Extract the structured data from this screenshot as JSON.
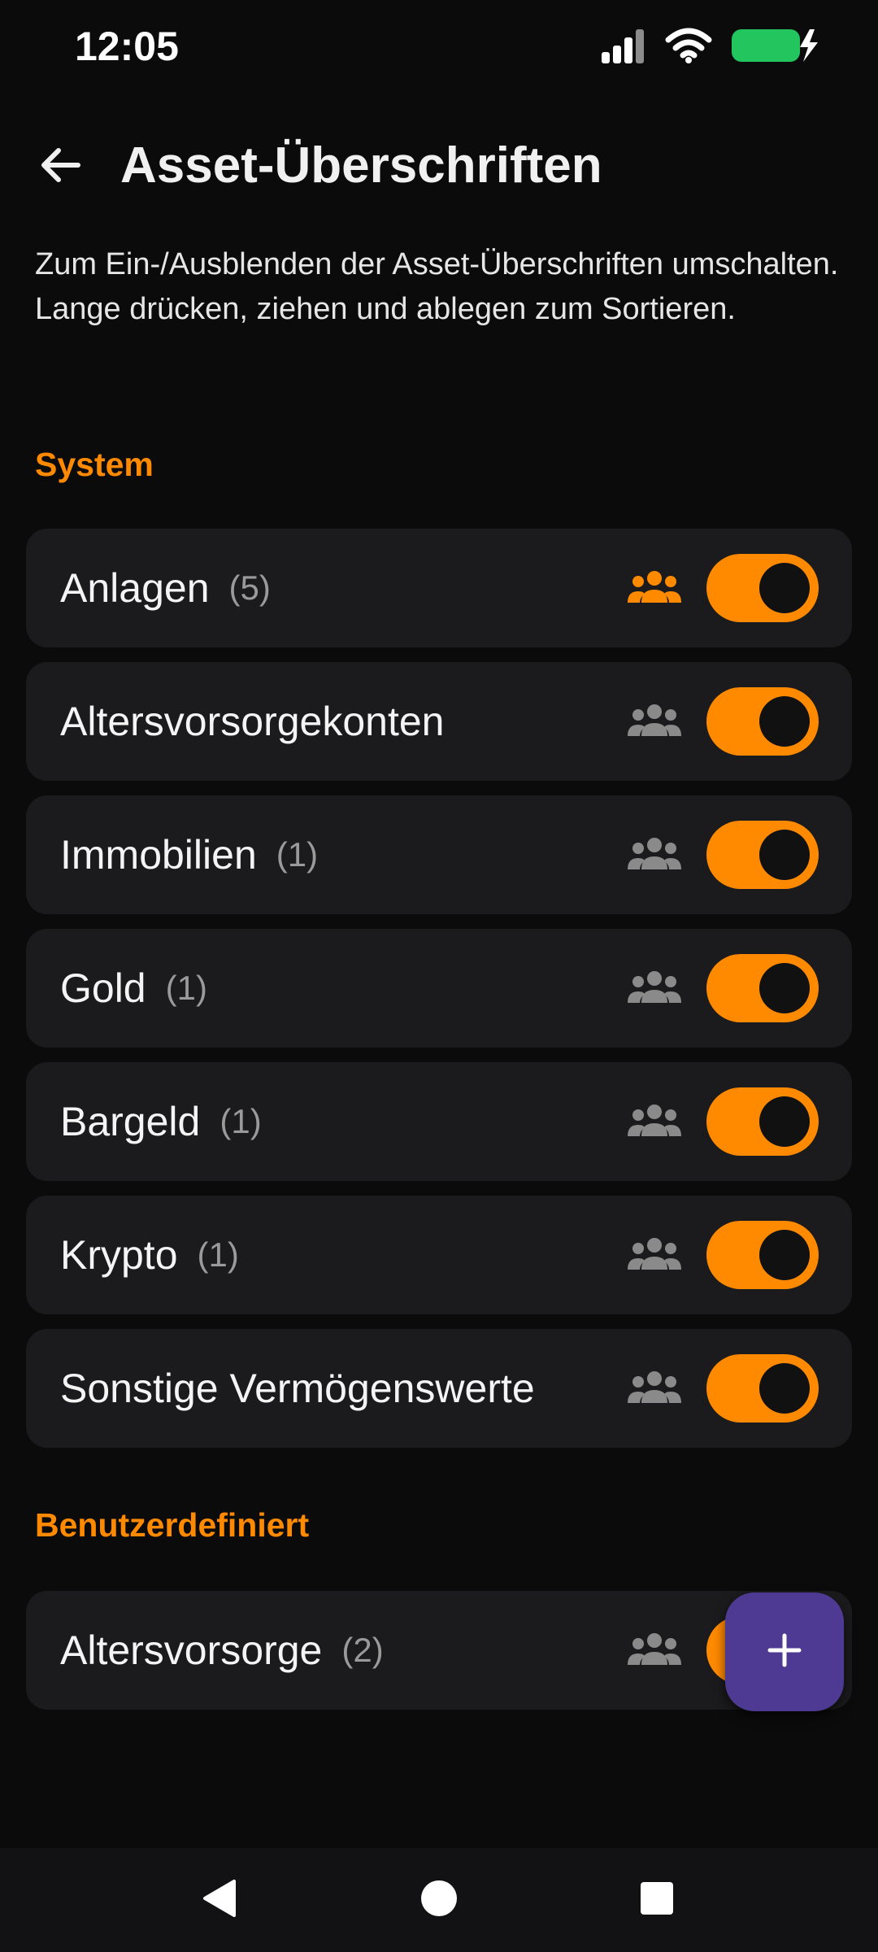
{
  "status_bar": {
    "time": "12:05",
    "icons": [
      "signal-icon",
      "wifi-icon",
      "battery-charging-icon"
    ],
    "battery_color": "#22c55e"
  },
  "header": {
    "title": "Asset-Überschriften",
    "back_icon": "arrow-left-icon"
  },
  "description": "Zum Ein-/Ausblenden der Asset-Überschriften umschalten. Lange drücken, ziehen und ablegen zum Sortieren.",
  "sections": [
    {
      "title": "System",
      "items": [
        {
          "label": "Anlagen",
          "count": "(5)",
          "shared_icon_active": true,
          "enabled": true
        },
        {
          "label": "Altersvorsorgekonten",
          "count": "",
          "shared_icon_active": false,
          "enabled": true
        },
        {
          "label": "Immobilien",
          "count": "(1)",
          "shared_icon_active": false,
          "enabled": true
        },
        {
          "label": "Gold",
          "count": "(1)",
          "shared_icon_active": false,
          "enabled": true
        },
        {
          "label": "Bargeld",
          "count": "(1)",
          "shared_icon_active": false,
          "enabled": true
        },
        {
          "label": "Krypto",
          "count": "(1)",
          "shared_icon_active": false,
          "enabled": true
        },
        {
          "label": "Sonstige Vermögenswerte",
          "count": "",
          "shared_icon_active": false,
          "enabled": true
        }
      ]
    },
    {
      "title": "Benutzerdefiniert",
      "items": [
        {
          "label": "Altersvorsorge",
          "count": "(2)",
          "shared_icon_active": false,
          "enabled": true
        }
      ]
    }
  ],
  "fab": {
    "icon": "plus-icon"
  },
  "colors": {
    "accent": "#ff8a00",
    "fab": "#4e3a92",
    "background": "#0b0b0c",
    "card": "#1b1b1d",
    "icon_inactive": "#8a8a8a"
  },
  "nav": {
    "icons": [
      "back-triangle-icon",
      "home-circle-icon",
      "recents-square-icon"
    ]
  }
}
